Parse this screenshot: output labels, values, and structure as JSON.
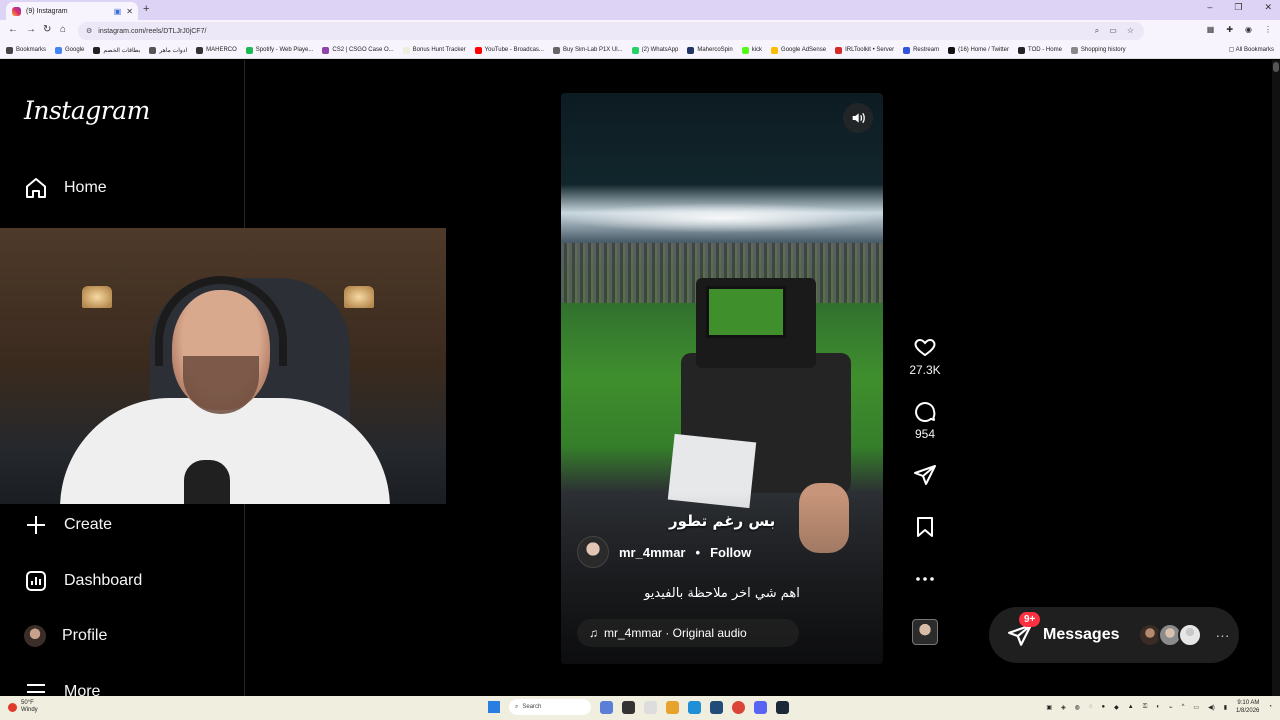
{
  "browser": {
    "tab_title": "(9) Instagram",
    "url": "instagram.com/reels/DTLJrJ0jCF7/",
    "bookmarks": [
      {
        "label": "Bookmarks",
        "color": "#444444"
      },
      {
        "label": "Google",
        "color": "#4285f4"
      },
      {
        "label": "بطاقات الخصم",
        "color": "#222222"
      },
      {
        "label": "ادوات ماهر",
        "color": "#555555"
      },
      {
        "label": "MAHERCO",
        "color": "#333333"
      },
      {
        "label": "Spotify - Web Playe...",
        "color": "#1db954"
      },
      {
        "label": "CS2 | CSGO Case O...",
        "color": "#8e44ad"
      },
      {
        "label": "Bonus Hunt Tracker",
        "color": "#f0eedf"
      },
      {
        "label": "YouTube - Broadcas...",
        "color": "#ff0000"
      },
      {
        "label": "Buy Sim-Lab P1X Ul...",
        "color": "#666666"
      },
      {
        "label": "(2) WhatsApp",
        "color": "#25d366"
      },
      {
        "label": "MahercoSpin",
        "color": "#223366"
      },
      {
        "label": "kick",
        "color": "#53fc18"
      },
      {
        "label": "Google AdSense",
        "color": "#fbbc05"
      },
      {
        "label": "IRLToolkit • Server",
        "color": "#d62828"
      },
      {
        "label": "Restream",
        "color": "#3355dd"
      },
      {
        "label": "(16) Home / Twitter",
        "color": "#111111"
      },
      {
        "label": "TOD - Home",
        "color": "#222222"
      },
      {
        "label": "Shopping history",
        "color": "#888888"
      }
    ],
    "all_bookmarks": "All Bookmarks"
  },
  "sidebar": {
    "logo": "Instagram",
    "items": [
      {
        "label": "Home",
        "icon": "home-icon"
      },
      {
        "label": "Create",
        "icon": "plus-icon"
      },
      {
        "label": "Dashboard",
        "icon": "dashboard-icon"
      },
      {
        "label": "Profile",
        "icon": "avatar"
      },
      {
        "label": "More",
        "icon": "menu-icon"
      }
    ]
  },
  "reel": {
    "caption_overlay": "بس رغم تطور",
    "username": "mr_4mmar",
    "separator": "•",
    "follow_label": "Follow",
    "description": "اهم شي اخر ملاحظة بالفيديو",
    "audio_label": "mr_4mmar · Original audio"
  },
  "actions": {
    "likes": "27.3K",
    "comments": "954"
  },
  "messages": {
    "label": "Messages",
    "badge": "9+"
  },
  "taskbar": {
    "weather_temp": "50°F",
    "weather_desc": "Windy",
    "search_placeholder": "Search",
    "time": "9:10 AM",
    "date": "1/8/2026"
  }
}
